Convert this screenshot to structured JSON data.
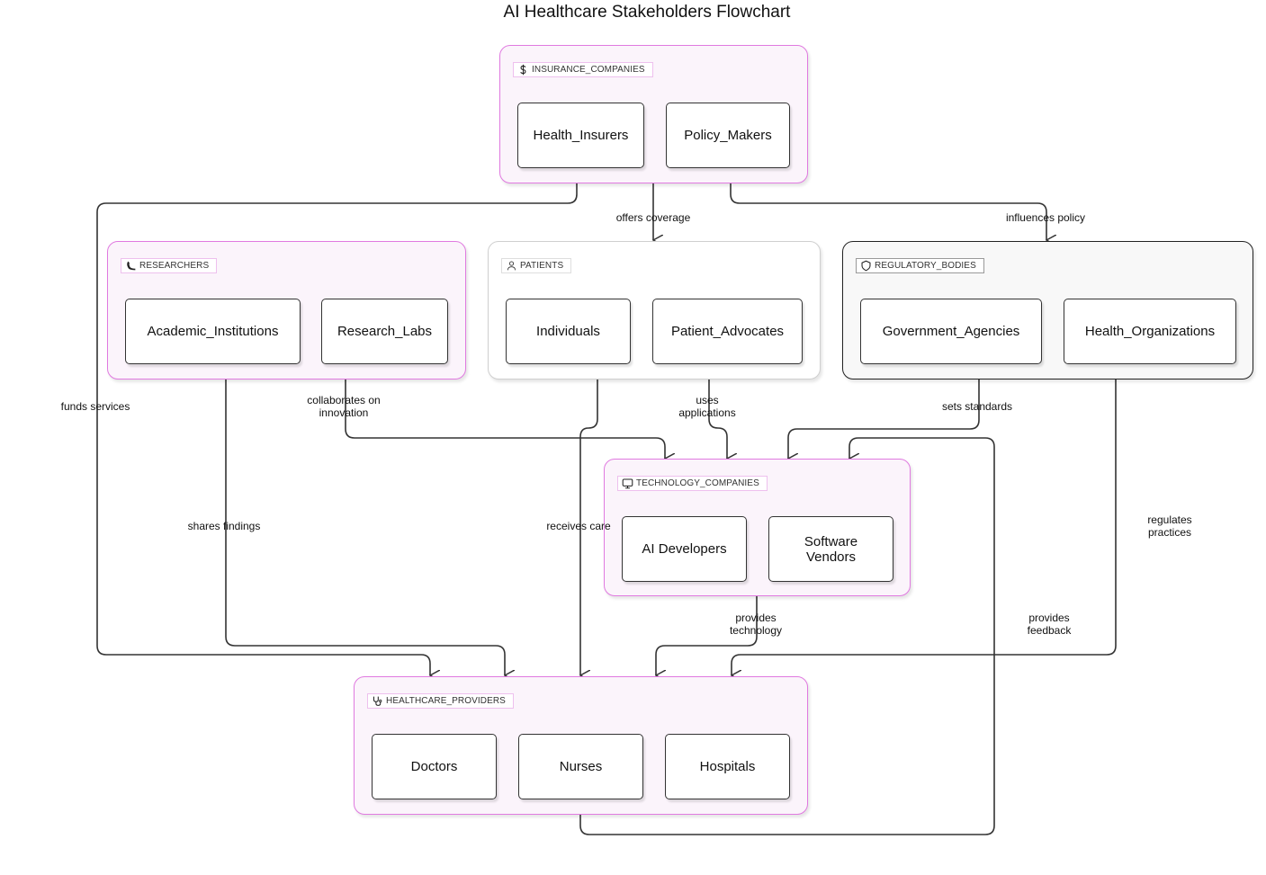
{
  "title": "AI Healthcare Stakeholders Flowchart",
  "colors": {
    "group_pink_border": "#e07ae0",
    "group_pink_fill": "#fbf4fb",
    "group_dark_border": "#222222",
    "edge": "#333333"
  },
  "groups": {
    "insurance": {
      "label": "INSURANCE_COMPANIES",
      "icon": "dollar-icon",
      "nodes": [
        "Health_Insurers",
        "Policy_Makers"
      ]
    },
    "researchers": {
      "label": "RESEARCHERS",
      "icon": "flask-icon",
      "nodes": [
        "Academic_Institutions",
        "Research_Labs"
      ]
    },
    "patients": {
      "label": "PATIENTS",
      "icon": "user-icon",
      "nodes": [
        "Individuals",
        "Patient_Advocates"
      ]
    },
    "regulatory": {
      "label": "REGULATORY_BODIES",
      "icon": "shield-icon",
      "nodes": [
        "Government_Agencies",
        "Health_Organizations"
      ]
    },
    "technology": {
      "label": "TECHNOLOGY_COMPANIES",
      "icon": "monitor-icon",
      "nodes": [
        "AI Developers",
        "Software\nVendors"
      ]
    },
    "providers": {
      "label": "HEALTHCARE_PROVIDERS",
      "icon": "stethoscope-icon",
      "nodes": [
        "Doctors",
        "Nurses",
        "Hospitals"
      ]
    }
  },
  "edges": [
    {
      "from": "INSURANCE_COMPANIES",
      "to": "PATIENTS",
      "label": "offers coverage"
    },
    {
      "from": "INSURANCE_COMPANIES",
      "to": "REGULATORY_BODIES",
      "label": "influences policy"
    },
    {
      "from": "INSURANCE_COMPANIES",
      "to": "HEALTHCARE_PROVIDERS",
      "label": "funds services"
    },
    {
      "from": "RESEARCHERS",
      "to": "TECHNOLOGY_COMPANIES",
      "label": "collaborates on\ninnovation"
    },
    {
      "from": "RESEARCHERS",
      "to": "HEALTHCARE_PROVIDERS",
      "label": "shares findings"
    },
    {
      "from": "PATIENTS",
      "to": "TECHNOLOGY_COMPANIES",
      "label": "uses\napplications"
    },
    {
      "from": "PATIENTS",
      "to": "HEALTHCARE_PROVIDERS",
      "label": "receives care"
    },
    {
      "from": "REGULATORY_BODIES",
      "to": "TECHNOLOGY_COMPANIES",
      "label": "sets standards"
    },
    {
      "from": "REGULATORY_BODIES",
      "to": "HEALTHCARE_PROVIDERS",
      "label": "regulates\npractices"
    },
    {
      "from": "TECHNOLOGY_COMPANIES",
      "to": "HEALTHCARE_PROVIDERS",
      "label": "provides\ntechnology"
    },
    {
      "from": "HEALTHCARE_PROVIDERS",
      "to": "TECHNOLOGY_COMPANIES",
      "label": "provides\nfeedback"
    }
  ]
}
